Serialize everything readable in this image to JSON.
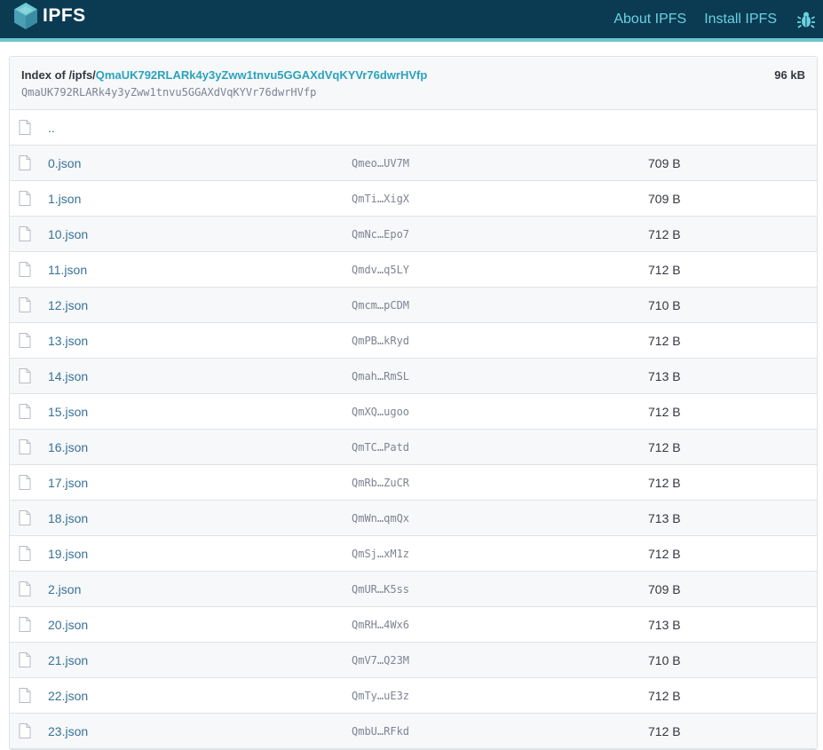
{
  "header": {
    "logo_text": "IPFS",
    "nav": [
      "About IPFS",
      "Install IPFS"
    ],
    "accent_color": "#69c4cd",
    "bg_color": "#0b3a53"
  },
  "index": {
    "prefix": "Index of /ipfs/",
    "hash": "QmaUK792RLARk4y3yZww1tnvu5GGAXdVqKYVr76dwrHVfp",
    "hash_sub": "QmaUK792RLARk4y3yZww1tnvu5GGAXdVqKYVr76dwrHVfp",
    "total_size": "96 kB"
  },
  "parent_link": "..",
  "files": [
    {
      "name": "0.json",
      "hash": "Qmeo…UV7M",
      "size": "709 B"
    },
    {
      "name": "1.json",
      "hash": "QmTi…XigX",
      "size": "709 B"
    },
    {
      "name": "10.json",
      "hash": "QmNc…Epo7",
      "size": "712 B"
    },
    {
      "name": "11.json",
      "hash": "Qmdv…q5LY",
      "size": "712 B"
    },
    {
      "name": "12.json",
      "hash": "Qmcm…pCDM",
      "size": "710 B"
    },
    {
      "name": "13.json",
      "hash": "QmPB…kRyd",
      "size": "712 B"
    },
    {
      "name": "14.json",
      "hash": "Qmah…RmSL",
      "size": "713 B"
    },
    {
      "name": "15.json",
      "hash": "QmXQ…ugoo",
      "size": "712 B"
    },
    {
      "name": "16.json",
      "hash": "QmTC…Patd",
      "size": "712 B"
    },
    {
      "name": "17.json",
      "hash": "QmRb…ZuCR",
      "size": "712 B"
    },
    {
      "name": "18.json",
      "hash": "QmWn…qmQx",
      "size": "713 B"
    },
    {
      "name": "19.json",
      "hash": "QmSj…xM1z",
      "size": "712 B"
    },
    {
      "name": "2.json",
      "hash": "QmUR…K5ss",
      "size": "709 B"
    },
    {
      "name": "20.json",
      "hash": "QmRH…4Wx6",
      "size": "713 B"
    },
    {
      "name": "21.json",
      "hash": "QmV7…Q23M",
      "size": "710 B"
    },
    {
      "name": "22.json",
      "hash": "QmTy…uE3z",
      "size": "712 B"
    },
    {
      "name": "23.json",
      "hash": "QmbU…RFkd",
      "size": "712 B"
    }
  ]
}
